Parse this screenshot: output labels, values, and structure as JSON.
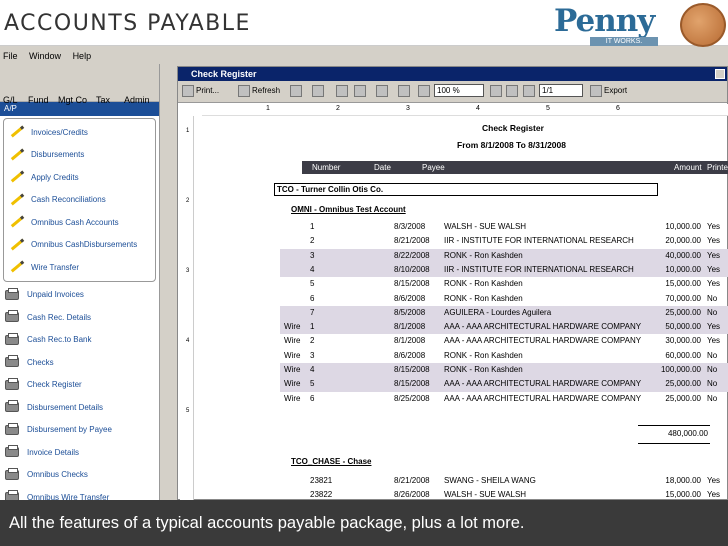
{
  "slide": {
    "title": "ACCOUNTS PAYABLE",
    "logo_text": "Penny",
    "logo_tagline": "IT WORKS.",
    "caption": "All the features of a typical accounts payable package, plus a lot more."
  },
  "menu": [
    "File",
    "Window",
    "Help"
  ],
  "left_tabs": [
    "G/L",
    "Fund",
    "Mgt Co",
    "Tax",
    "Admin"
  ],
  "left_section_title": "A/P",
  "nav_boxed": [
    "Invoices/Credits",
    "Disbursements",
    "Apply Credits",
    "Cash Reconciliations",
    "Omnibus Cash Accounts",
    "Omnibus CashDisbursements",
    "Wire Transfer"
  ],
  "nav_reports": [
    "Unpaid Invoices",
    "Cash Rec. Details",
    "Cash Rec.to Bank",
    "Checks",
    "Check Register",
    "Disbursement Details",
    "Disbursement by Payee",
    "Invoice Details",
    "Omnibus Checks",
    "Omnibus Wire Transfer"
  ],
  "window": {
    "title": "Check Register",
    "toolbar": {
      "print": "Print...",
      "refresh": "Refresh",
      "zoom": "100 %",
      "page": "1/1",
      "export": "Export"
    }
  },
  "report": {
    "title": "Check Register",
    "range": "From 8/1/2008 To 8/31/2008",
    "columns": {
      "number": "Number",
      "date": "Date",
      "payee": "Payee",
      "amount": "Amount",
      "printed": "Printe"
    },
    "group": "TCO - Turner Collin Otis Co.",
    "account1": "OMNI - Omnibus Test Account",
    "rows": [
      {
        "type": "",
        "number": "1",
        "date": "8/3/2008",
        "payee": "WALSH - SUE WALSH",
        "amount": "10,000.00",
        "printed": "Yes",
        "shaded": false
      },
      {
        "type": "",
        "number": "2",
        "date": "8/21/2008",
        "payee": "IIR - INSTITUTE FOR INTERNATIONAL RESEARCH",
        "amount": "20,000.00",
        "printed": "Yes",
        "shaded": false
      },
      {
        "type": "",
        "number": "3",
        "date": "8/22/2008",
        "payee": "RONK - Ron Kashden",
        "amount": "40,000.00",
        "printed": "Yes",
        "shaded": true
      },
      {
        "type": "",
        "number": "4",
        "date": "8/10/2008",
        "payee": "IIR - INSTITUTE FOR INTERNATIONAL RESEARCH",
        "amount": "10,000.00",
        "printed": "Yes",
        "shaded": true
      },
      {
        "type": "",
        "number": "5",
        "date": "8/15/2008",
        "payee": "RONK - Ron Kashden",
        "amount": "15,000.00",
        "printed": "Yes",
        "shaded": false
      },
      {
        "type": "",
        "number": "6",
        "date": "8/6/2008",
        "payee": "RONK - Ron Kashden",
        "amount": "70,000.00",
        "printed": "No",
        "shaded": false
      },
      {
        "type": "",
        "number": "7",
        "date": "8/5/2008",
        "payee": "AGUILERA - Lourdes Aguilera",
        "amount": "25,000.00",
        "printed": "No",
        "shaded": true
      },
      {
        "type": "Wire",
        "number": "1",
        "date": "8/1/2008",
        "payee": "AAA - AAA ARCHITECTURAL HARDWARE COMPANY",
        "amount": "50,000.00",
        "printed": "Yes",
        "shaded": true
      },
      {
        "type": "Wire",
        "number": "2",
        "date": "8/1/2008",
        "payee": "AAA - AAA ARCHITECTURAL HARDWARE COMPANY",
        "amount": "30,000.00",
        "printed": "Yes",
        "shaded": false
      },
      {
        "type": "Wire",
        "number": "3",
        "date": "8/6/2008",
        "payee": "RONK - Ron Kashden",
        "amount": "60,000.00",
        "printed": "No",
        "shaded": false
      },
      {
        "type": "Wire",
        "number": "4",
        "date": "8/15/2008",
        "payee": "RONK - Ron Kashden",
        "amount": "100,000.00",
        "printed": "No",
        "shaded": true
      },
      {
        "type": "Wire",
        "number": "5",
        "date": "8/15/2008",
        "payee": "AAA - AAA ARCHITECTURAL HARDWARE COMPANY",
        "amount": "25,000.00",
        "printed": "No",
        "shaded": true
      },
      {
        "type": "Wire",
        "number": "6",
        "date": "8/25/2008",
        "payee": "AAA - AAA ARCHITECTURAL HARDWARE COMPANY",
        "amount": "25,000.00",
        "printed": "No",
        "shaded": false
      }
    ],
    "total": "480,000.00",
    "account2": "TCO_CHASE - Chase",
    "rows2": [
      {
        "type": "",
        "number": "23821",
        "date": "8/21/2008",
        "payee": "SWANG - SHEILA WANG",
        "amount": "18,000.00",
        "printed": "Yes",
        "shaded": false
      },
      {
        "type": "",
        "number": "23822",
        "date": "8/26/2008",
        "payee": "WALSH - SUE WALSH",
        "amount": "15,000.00",
        "printed": "Yes",
        "shaded": false
      }
    ]
  },
  "colors": {
    "title_bar": "#0a246a",
    "ap_bar": "#1c4e97",
    "column_bar": "#3c3c46",
    "row_shade": "#ddd8e4",
    "caption_bg": "#3a3a3a",
    "logo": "#2c6b97"
  }
}
